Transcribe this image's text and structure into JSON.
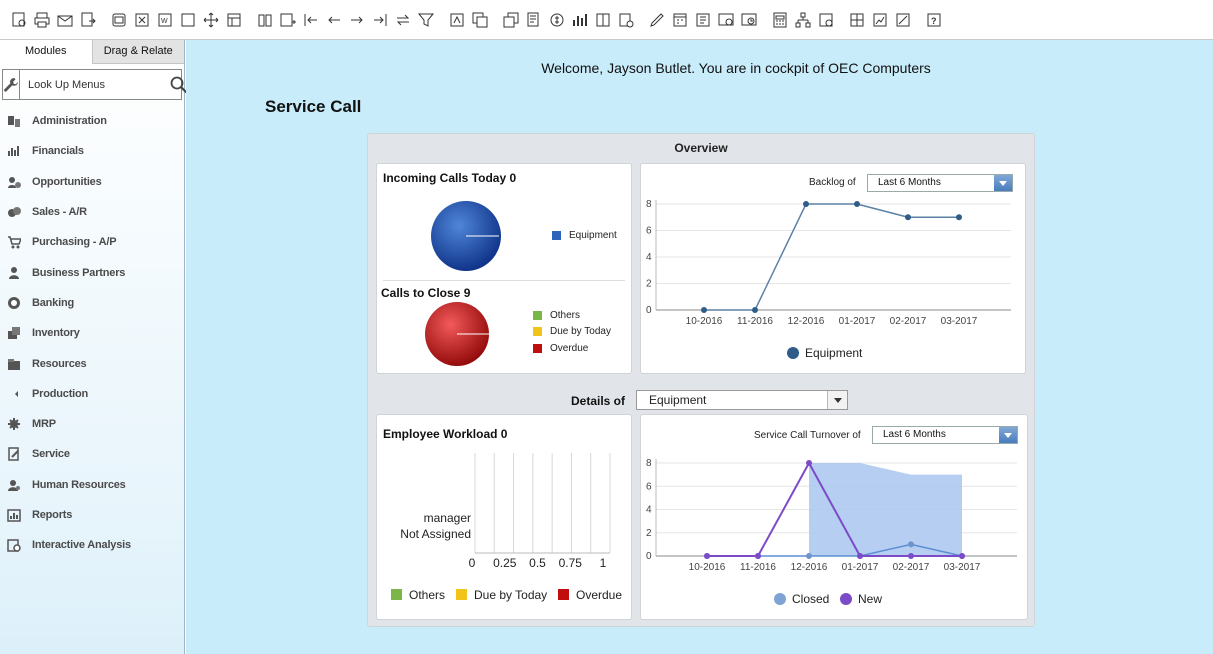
{
  "toolbar": {
    "icons": [
      "document-preview-icon",
      "print-icon",
      "email-icon",
      "export-icon",
      "print-preview-icon",
      "excel-icon",
      "word-icon",
      "blank-form-icon",
      "move-icon",
      "layout-icon",
      "binoculars-icon",
      "add-icon",
      "first-record-icon",
      "previous-record-icon",
      "next-record-icon",
      "last-record-icon",
      "refresh-icon",
      "filter-icon",
      "sort-icon",
      "base-document-icon",
      "target-document-icon",
      "journal-icon",
      "payment-icon",
      "chart-icon",
      "layout-designer-icon",
      "settings-icon",
      "edit-icon",
      "calendar-icon",
      "report-icon",
      "messages-icon",
      "alerts-icon",
      "calculator-icon",
      "org-chart-icon",
      "dashboard-icon",
      "widgets-icon",
      "image-icon",
      "analysis-icon",
      "help-icon"
    ]
  },
  "sidebar": {
    "tabs": {
      "modules": "Modules",
      "drag_relate": "Drag & Relate"
    },
    "lookup": {
      "value": "Look Up Menus"
    },
    "items": [
      {
        "label": "Administration",
        "icon": "administration-icon"
      },
      {
        "label": "Financials",
        "icon": "financials-icon"
      },
      {
        "label": "Opportunities",
        "icon": "opportunities-icon"
      },
      {
        "label": "Sales - A/R",
        "icon": "sales-icon"
      },
      {
        "label": "Purchasing - A/P",
        "icon": "purchasing-cart-icon"
      },
      {
        "label": "Business Partners",
        "icon": "business-partners-icon"
      },
      {
        "label": "Banking",
        "icon": "banking-icon"
      },
      {
        "label": "Inventory",
        "icon": "inventory-icon"
      },
      {
        "label": "Resources",
        "icon": "resources-icon"
      },
      {
        "label": "Production",
        "icon": "production-icon"
      },
      {
        "label": "MRP",
        "icon": "mrp-icon"
      },
      {
        "label": "Service",
        "icon": "service-icon"
      },
      {
        "label": "Human Resources",
        "icon": "human-resources-icon"
      },
      {
        "label": "Reports",
        "icon": "reports-icon"
      },
      {
        "label": "Interactive Analysis",
        "icon": "interactive-analysis-icon"
      }
    ]
  },
  "main": {
    "welcome": "Welcome, Jayson Butlet. You are in cockpit of OEC Computers",
    "title": "Service Call",
    "overview_title": "Overview",
    "details_label": "Details of",
    "details_value": "Equipment"
  },
  "colors": {
    "equipment": "#2e64b8",
    "others": "#7ab648",
    "due_by_today": "#f0c419",
    "overdue": "#c00d0d",
    "line": "#5b82a6",
    "closed": "#7ea3d4",
    "new": "#7b4bc8",
    "area": "#a9c5ef"
  },
  "chart_data": [
    {
      "type": "pie",
      "title": "Incoming Calls Today 0",
      "slices": [
        {
          "label": "Equipment",
          "value": 0
        }
      ]
    },
    {
      "type": "pie",
      "title": "Calls to Close 9",
      "slices": [
        {
          "label": "Others",
          "value": 0
        },
        {
          "label": "Due by Today",
          "value": 0
        },
        {
          "label": "Overdue",
          "value": 9
        }
      ]
    },
    {
      "type": "line",
      "control_label": "Backlog of",
      "control_value": "Last 6 Months",
      "categories": [
        "10-2016",
        "11-2016",
        "12-2016",
        "01-2017",
        "02-2017",
        "03-2017"
      ],
      "y_ticks": [
        0,
        2,
        4,
        6,
        8
      ],
      "ylim": [
        0,
        8
      ],
      "series": [
        {
          "name": "Equipment",
          "values": [
            0,
            0,
            8,
            8,
            7,
            7
          ]
        }
      ]
    },
    {
      "type": "bar",
      "title": "Employee Workload 0",
      "categories": [
        "manager",
        "Not Assigned"
      ],
      "x_ticks": [
        "0",
        "0.25",
        "0.5",
        "0.75",
        "1"
      ],
      "xlim": [
        0,
        1
      ],
      "series": [
        {
          "name": "Others",
          "values": [
            0,
            0
          ]
        },
        {
          "name": "Due by Today",
          "values": [
            0,
            0
          ]
        },
        {
          "name": "Overdue",
          "values": [
            0,
            0
          ]
        }
      ]
    },
    {
      "type": "line",
      "control_label": "Service Call Turnover of",
      "control_value": "Last 6 Months",
      "categories": [
        "10-2016",
        "11-2016",
        "12-2016",
        "01-2017",
        "02-2017",
        "03-2017"
      ],
      "y_ticks": [
        0,
        2,
        4,
        6,
        8
      ],
      "ylim": [
        0,
        8
      ],
      "area": [
        null,
        null,
        8,
        8,
        7,
        7
      ],
      "series": [
        {
          "name": "Closed",
          "values": [
            0,
            0,
            0,
            0,
            1,
            0
          ]
        },
        {
          "name": "New",
          "values": [
            0,
            0,
            8,
            0,
            0,
            0
          ]
        }
      ]
    }
  ]
}
